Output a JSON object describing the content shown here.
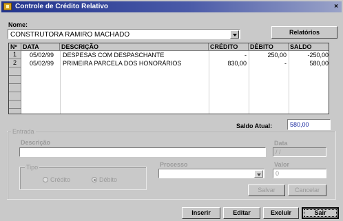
{
  "window": {
    "title": "Controle de Crédito Relativo",
    "close_label": "×"
  },
  "nome": {
    "label": "Nome:",
    "value": "CONSTRUTORA RAMIRO MACHADO"
  },
  "relatorios_label": "Relatórios",
  "table": {
    "columns": [
      "Nº",
      "DATA",
      "DESCRIÇÃO",
      "CRÉDITO",
      "DÉBITO",
      "SALDO"
    ],
    "rows": [
      {
        "n": "1",
        "data": "05/02/99",
        "descricao": "DESPESAS COM DESPASCHANTE",
        "credito": "-",
        "debito": "250,00",
        "saldo": "-250,00"
      },
      {
        "n": "2",
        "data": "05/02/99",
        "descricao": "PRIMEIRA PARCELA DOS HONORÁRIOS",
        "credito": "830,00",
        "debito": "-",
        "saldo": "580,00"
      }
    ]
  },
  "saldo_atual": {
    "label": "Saldo Atual:",
    "value": "580,00"
  },
  "entrada": {
    "legend": "Entrada",
    "descricao_label": "Descrição",
    "data_label": "Data",
    "data_value": "/ /",
    "tipo_label": "Tipo",
    "credito_label": "Crédito",
    "debito_label": "Débito",
    "processo_label": "Processo",
    "valor_label": "Valor",
    "valor_value": "0",
    "salvar_label": "Salvar",
    "cancelar_label": "Cancelar"
  },
  "buttons": {
    "inserir": "Inserir",
    "editar": "Editar",
    "excluir": "Excluir",
    "sair": "Sair"
  },
  "colors": {
    "titlebar": "#22348d",
    "window": "#c9c9c9"
  }
}
